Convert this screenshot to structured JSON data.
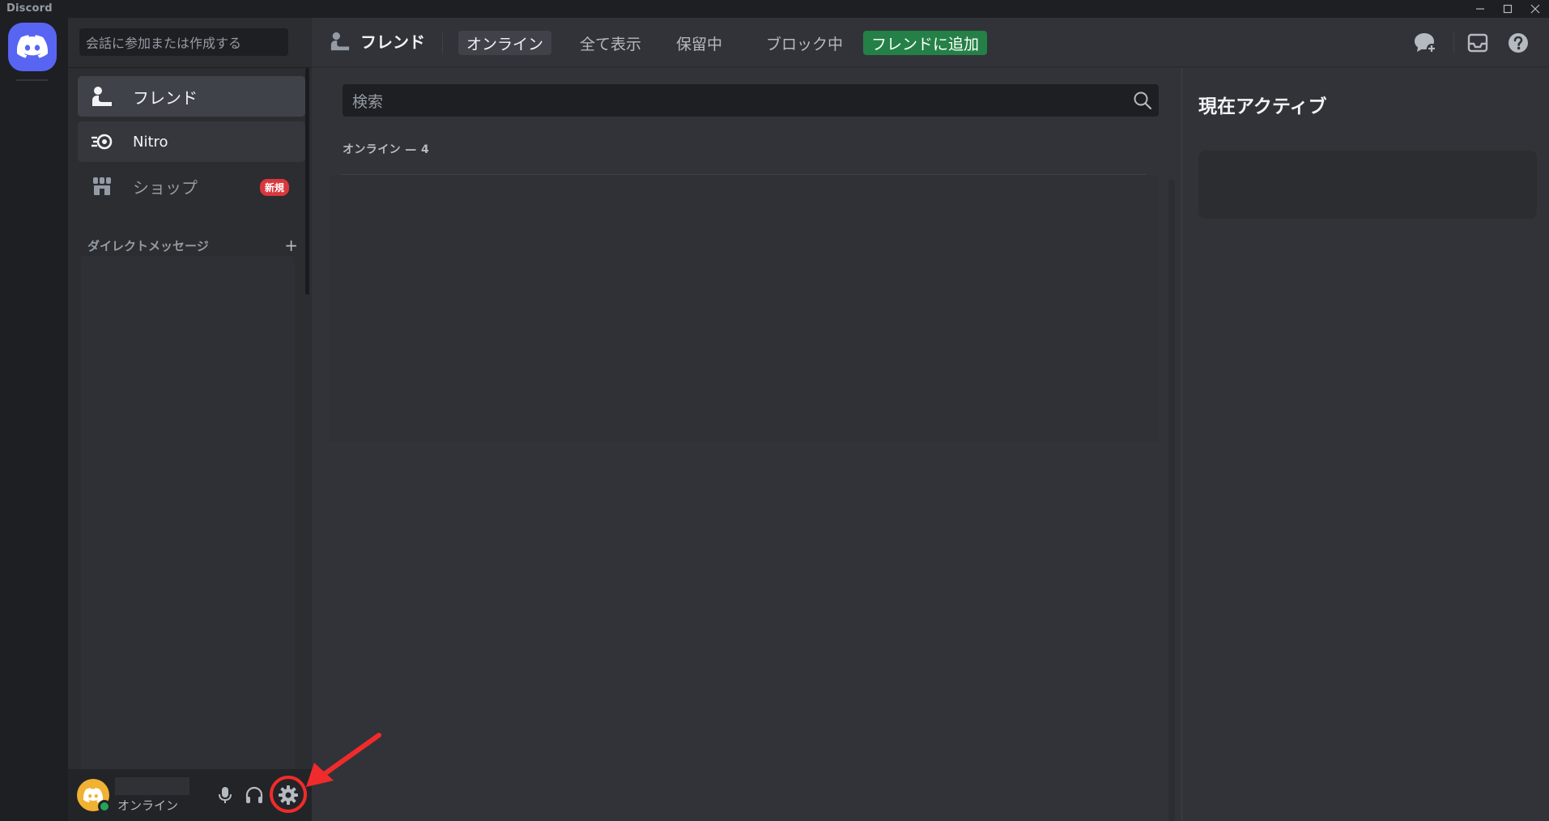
{
  "window": {
    "title": "Discord",
    "controls": [
      "minimize-icon",
      "maximize-icon",
      "close-icon"
    ]
  },
  "colors": {
    "brand": "#5865f2",
    "online": "#23a559",
    "add_friend": "#248046",
    "badge_new": "#da373c",
    "annotation": "#f02b2b"
  },
  "sidebar": {
    "search_placeholder": "会話に参加または作成する",
    "items": [
      {
        "label": "フレンド",
        "icon": "friends-icon",
        "selected": true
      },
      {
        "label": "Nitro",
        "icon": "nitro-icon",
        "selected": false
      },
      {
        "label": "ショップ",
        "icon": "shop-icon",
        "badge": "新規"
      }
    ],
    "dm_header": "ダイレクトメッセージ",
    "dm_add": "+"
  },
  "user_panel": {
    "status": "オンライン",
    "controls": [
      "microphone-icon",
      "headphones-icon",
      "settings-icon"
    ]
  },
  "header": {
    "title": "フレンド",
    "tabs": [
      {
        "label": "オンライン",
        "active": true
      },
      {
        "label": "全て表示",
        "active": false
      },
      {
        "label": "保留中",
        "active": false
      },
      {
        "label": "ブロック中",
        "active": false
      }
    ],
    "add_friend": "フレンドに追加",
    "right_icons": [
      "new-group-dm-icon",
      "inbox-icon",
      "help-icon"
    ]
  },
  "friends": {
    "search_placeholder": "検索",
    "online_count_label": "オンライン — 4"
  },
  "active_now": {
    "title": "現在アクティブ"
  }
}
